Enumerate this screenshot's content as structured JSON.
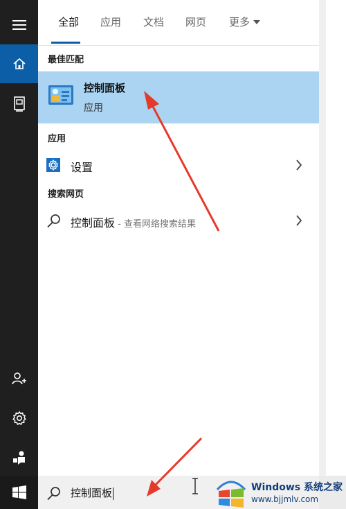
{
  "tabs": [
    {
      "label": "全部",
      "active": true
    },
    {
      "label": "应用",
      "active": false
    },
    {
      "label": "文档",
      "active": false
    },
    {
      "label": "网页",
      "active": false
    },
    {
      "label": "更多",
      "active": false
    }
  ],
  "sections": {
    "best_match": "最佳匹配",
    "apps": "应用",
    "web": "搜索网页"
  },
  "best_match_item": {
    "title": "控制面板",
    "subtitle": "应用",
    "icon": "control-panel-icon"
  },
  "apps_items": [
    {
      "label": "设置",
      "icon": "settings-gear-icon"
    }
  ],
  "web_items": [
    {
      "label": "控制面板",
      "suffix": " - 查看网络搜索结果",
      "icon": "search-icon"
    }
  ],
  "search": {
    "value": "控制面板"
  },
  "rail": {
    "icons": [
      "hamburger-menu-icon",
      "home-icon",
      "notebook-icon",
      "person-add-icon",
      "settings-icon",
      "feedback-icon",
      "windows-logo-icon"
    ]
  },
  "watermark": {
    "title": "Windows 系统之家",
    "url": "www.bjjmlv.com"
  },
  "colors": {
    "accent": "#0c5fa6",
    "selection": "#aad4f2",
    "rail": "#1f1f1f",
    "annotation": "#e53a2b"
  }
}
